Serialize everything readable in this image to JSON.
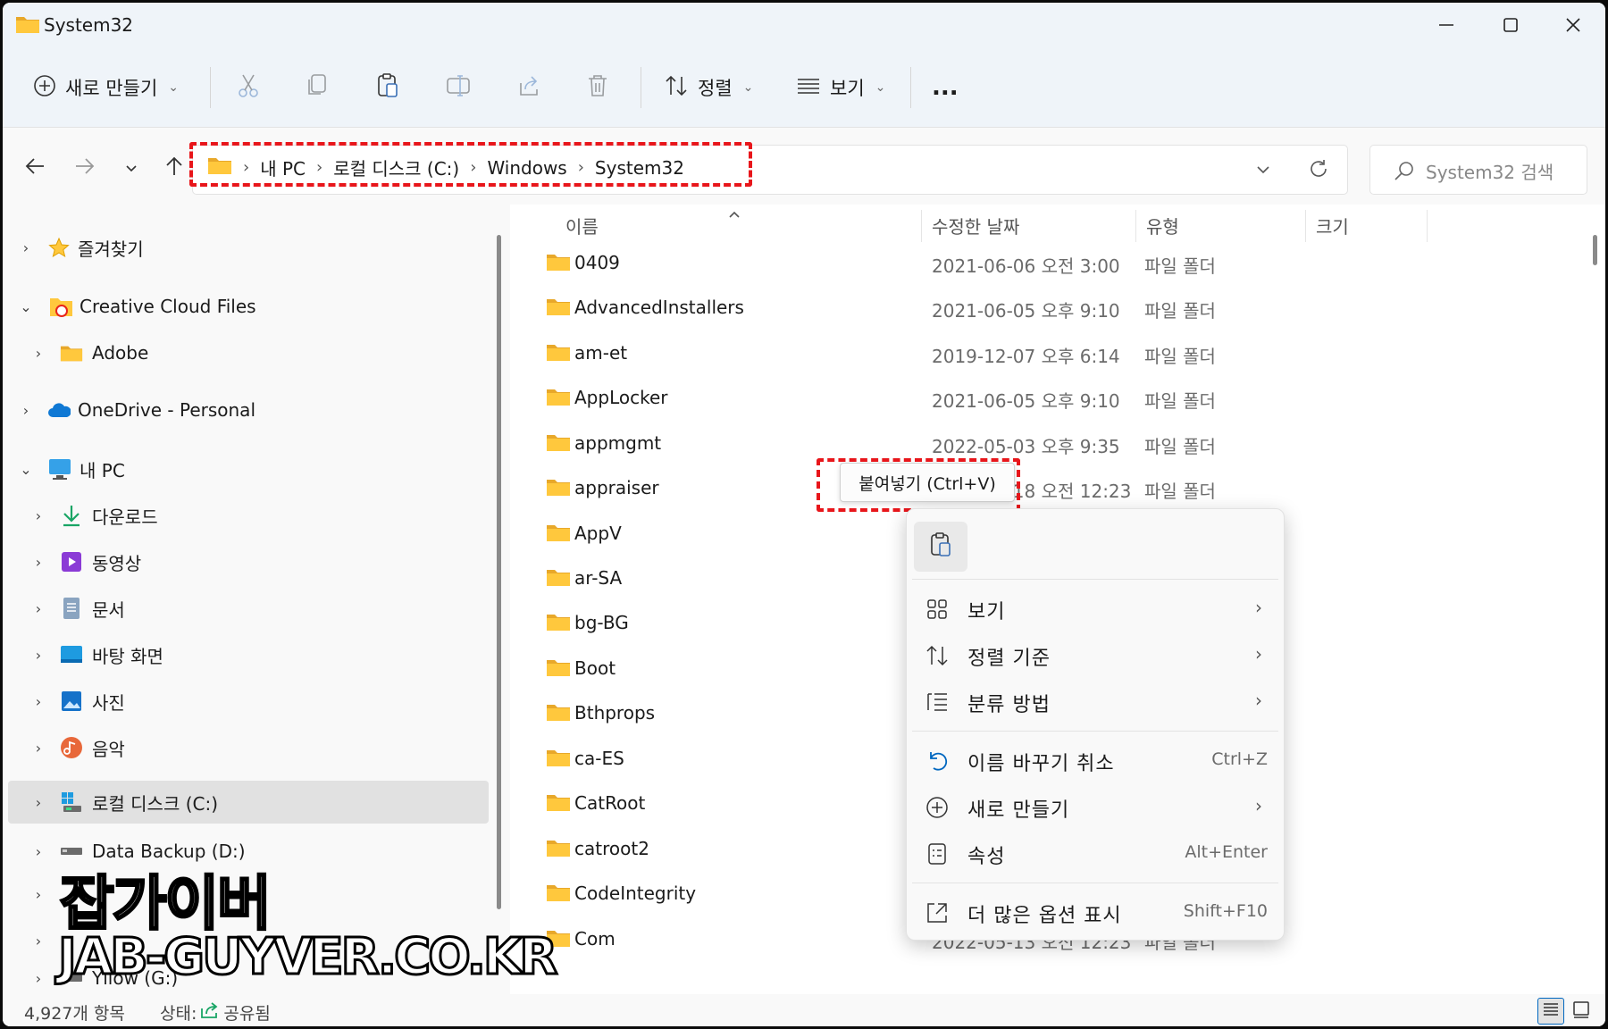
{
  "window": {
    "title": "System32"
  },
  "toolbar": {
    "new_label": "새로 만들기",
    "sort_label": "정렬",
    "view_label": "보기",
    "more_label": "..."
  },
  "breadcrumb": [
    "내 PC",
    "로컬 디스크 (C:)",
    "Windows",
    "System32"
  ],
  "search": {
    "placeholder": "System32 검색"
  },
  "nav": {
    "items": [
      {
        "label": "즐겨찾기",
        "icon": "star-icon"
      },
      {
        "label": "Creative Cloud Files",
        "icon": "creative-cloud-folder-icon"
      },
      {
        "label": "Adobe",
        "icon": "folder-icon"
      },
      {
        "label": "OneDrive - Personal",
        "icon": "onedrive-cloud-icon"
      },
      {
        "label": "내 PC",
        "icon": "monitor-icon"
      },
      {
        "label": "다운로드",
        "icon": "download-icon"
      },
      {
        "label": "동영상",
        "icon": "video-icon"
      },
      {
        "label": "문서",
        "icon": "document-icon"
      },
      {
        "label": "바탕 화면",
        "icon": "desktop-icon"
      },
      {
        "label": "사진",
        "icon": "picture-icon"
      },
      {
        "label": "음악",
        "icon": "music-icon"
      },
      {
        "label": "로컬 디스크 (C:)",
        "icon": "system-drive-icon"
      },
      {
        "label": "Data Backup (D:)",
        "icon": "drive-icon"
      },
      {
        "label": "Yllow (G:)",
        "icon": "drive-icon"
      }
    ]
  },
  "columns": {
    "name": "이름",
    "date": "수정한 날짜",
    "type": "유형",
    "size": "크기"
  },
  "files": [
    {
      "name": "0409",
      "date": "2021-06-06 오전 3:00",
      "type": "파일 폴더"
    },
    {
      "name": "AdvancedInstallers",
      "date": "2021-06-05 오후 9:10",
      "type": "파일 폴더"
    },
    {
      "name": "am-et",
      "date": "2019-12-07 오후 6:14",
      "type": "파일 폴더"
    },
    {
      "name": "AppLocker",
      "date": "2021-06-05 오후 9:10",
      "type": "파일 폴더"
    },
    {
      "name": "appmgmt",
      "date": "2022-05-03 오후 9:35",
      "type": "파일 폴더"
    },
    {
      "name": "appraiser",
      "date": "2022-05-18 오전 12:23",
      "type": "파일 폴더"
    },
    {
      "name": "AppV",
      "date": "",
      "type": ""
    },
    {
      "name": "ar-SA",
      "date": "",
      "type": ""
    },
    {
      "name": "bg-BG",
      "date": "",
      "type": ""
    },
    {
      "name": "Boot",
      "date": "",
      "type": ""
    },
    {
      "name": "Bthprops",
      "date": "",
      "type": ""
    },
    {
      "name": "ca-ES",
      "date": "",
      "type": ""
    },
    {
      "name": "CatRoot",
      "date": "",
      "type": ""
    },
    {
      "name": "catroot2",
      "date": "",
      "type": ""
    },
    {
      "name": "CodeIntegrity",
      "date": "",
      "type": ""
    },
    {
      "name": "Com",
      "date": "2022-05-13 오전 12:23",
      "type": "파일 폴더"
    }
  ],
  "status": {
    "count": "4,927개 항목",
    "state_label": "상태:",
    "state_value": "공유됨"
  },
  "tooltip": "붙여넣기 (Ctrl+V)",
  "context_menu": {
    "view": "보기",
    "sort_by": "정렬 기준",
    "group_by": "분류 방법",
    "undo_rename": "이름 바꾸기 취소",
    "undo_shortcut": "Ctrl+Z",
    "new": "새로 만들기",
    "properties": "속성",
    "properties_shortcut": "Alt+Enter",
    "more_options": "더 많은 옵션 표시",
    "more_shortcut": "Shift+F10"
  },
  "watermark": {
    "title": "잡가이버",
    "site": "JAB-GUYVER.CO.KR"
  },
  "colors": {
    "accent": "#0067c0",
    "folder": "#ffc83d",
    "highlight": "#e8161b"
  }
}
